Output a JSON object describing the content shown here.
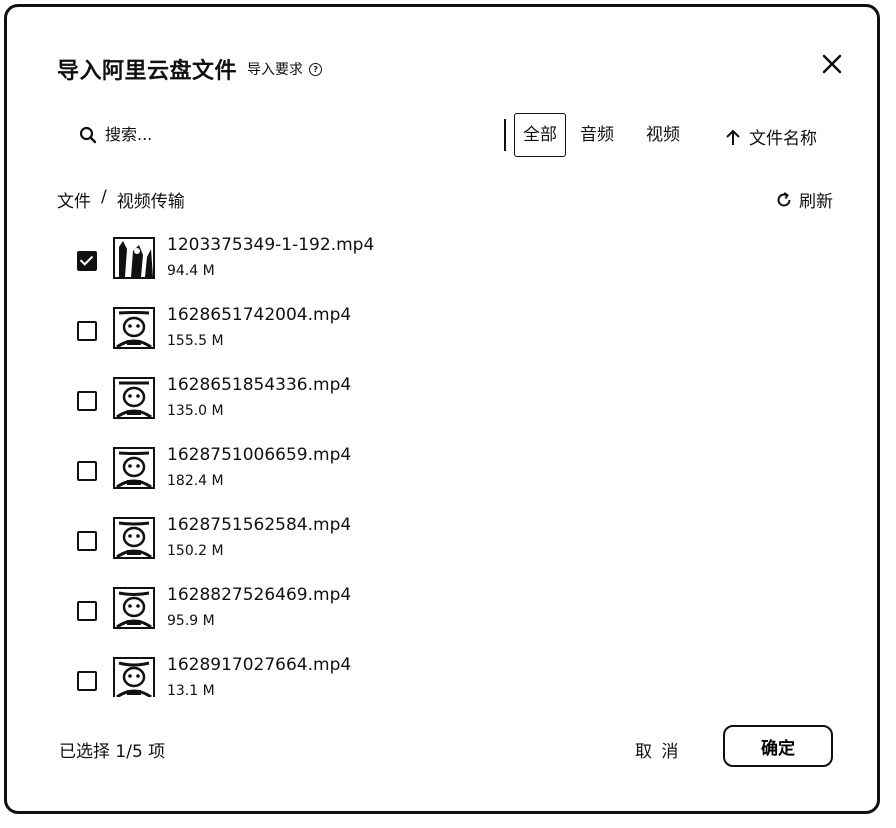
{
  "dialog": {
    "title": "导入阿里云盘文件",
    "requirements_link": "导入要求",
    "requirements_icon": "question-circle-icon",
    "close_icon": "close-icon"
  },
  "search": {
    "placeholder": "搜索...",
    "value": ""
  },
  "filters": [
    {
      "label": "全部",
      "active": true
    },
    {
      "label": "音频",
      "active": false
    },
    {
      "label": "视频",
      "active": false
    }
  ],
  "sort": {
    "label": "文件名称",
    "icon": "arrow-up-icon"
  },
  "breadcrumb": [
    "文件",
    "视频传输"
  ],
  "breadcrumb_separator": "/",
  "refresh": {
    "label": "刷新",
    "icon": "refresh-icon"
  },
  "files": [
    {
      "name": "1203375349-1-192.mp4",
      "size": "94.4 M",
      "checked": true
    },
    {
      "name": "1628651742004.mp4",
      "size": "155.5 M",
      "checked": false
    },
    {
      "name": "1628651854336.mp4",
      "size": "135.0 M",
      "checked": false
    },
    {
      "name": "1628751006659.mp4",
      "size": "182.4 M",
      "checked": false
    },
    {
      "name": "1628751562584.mp4",
      "size": "150.2 M",
      "checked": false
    },
    {
      "name": "1628827526469.mp4",
      "size": "95.9 M",
      "checked": false
    },
    {
      "name": "1628917027664.mp4",
      "size": "13.1 M",
      "checked": false
    }
  ],
  "footer": {
    "selection": "已选择 1/5 项",
    "cancel": "取 消",
    "confirm": "确定"
  }
}
